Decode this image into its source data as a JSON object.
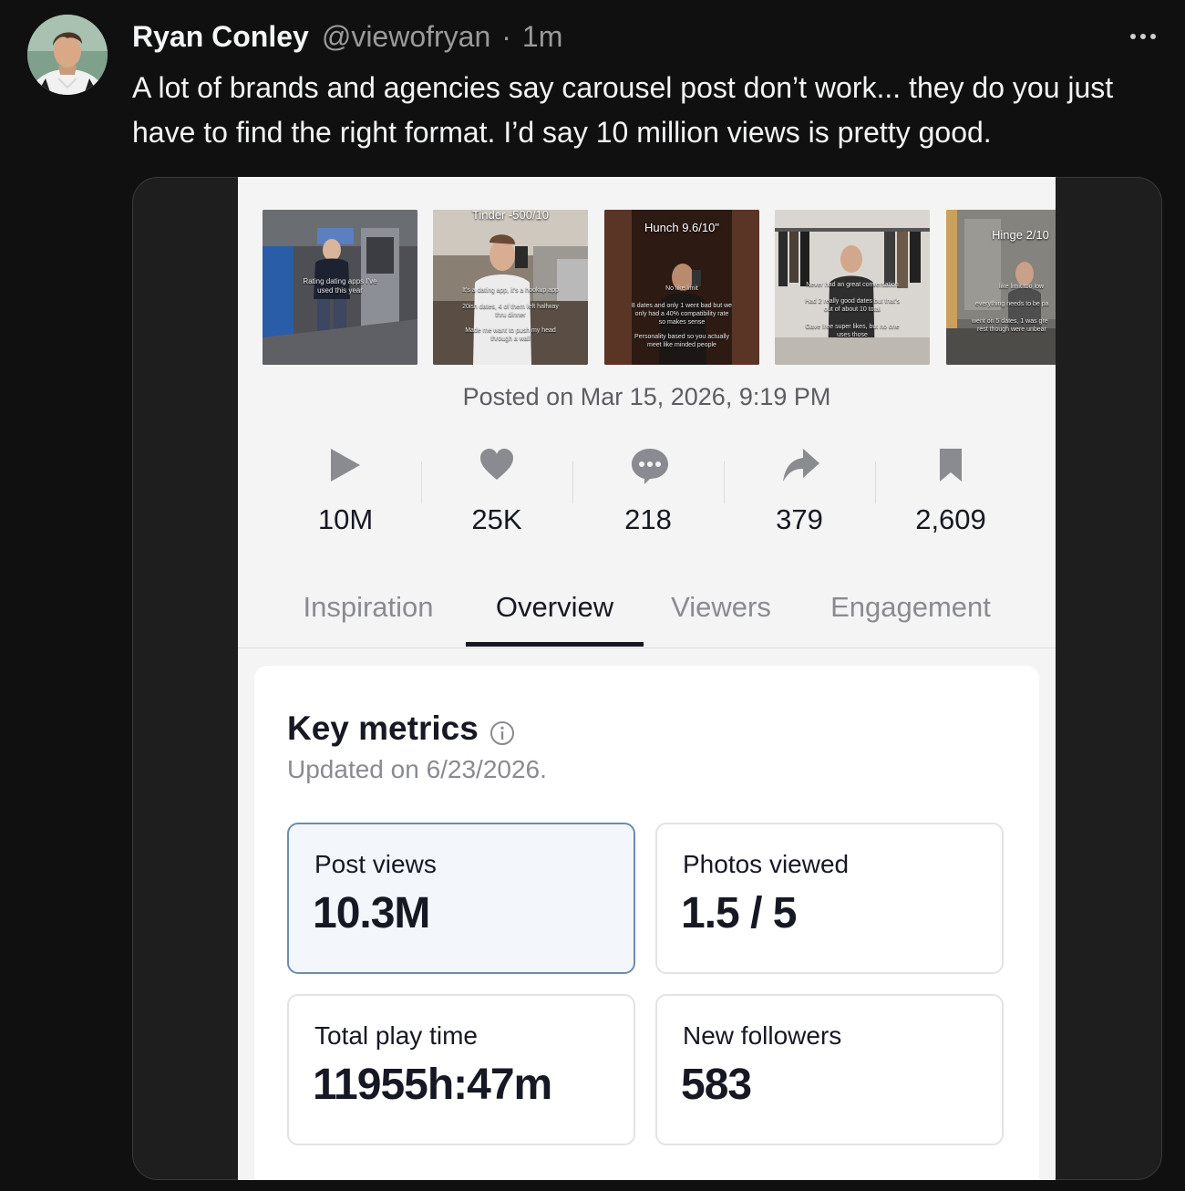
{
  "post": {
    "author": "Ryan Conley",
    "handle": "@viewofryan",
    "separator": "·",
    "time": "1m",
    "text": "A lot of brands and agencies say carousel post don’t work... they do you just have to find the right format. I’d say 10 million views is pretty good."
  },
  "embed": {
    "thumbnails": [
      {
        "caption": "",
        "lines": [
          "Rating dating apps I've",
          "used this year"
        ]
      },
      {
        "caption": "Tinder -500/10",
        "lines": [
          "It's a dating app, it's a hookup app",
          "20ish dates, 4 of them left halfway",
          "thru dinner",
          "Made me want to push my head",
          "through a wall"
        ]
      },
      {
        "caption": "Hunch 9.6/10\"",
        "lines": [
          "No like limit",
          "8 dates and only 1 went bad but we",
          "only had a 40% compatibility rate",
          "so makes sense",
          "Personality based so you actually",
          "meet like minded people"
        ]
      },
      {
        "caption": "",
        "lines": [
          "Never had an great conversation",
          "Had 2 really good dates but that's",
          "out of about 10 total",
          "Gave free super likes, but no one",
          "uses those"
        ]
      },
      {
        "caption": "Hinge 2/10",
        "lines": [
          "like limit too low",
          "everything needs to be pa",
          "went on 5 dates, 1 was gre",
          "rest though were unbear"
        ]
      }
    ],
    "posted_on": "Posted on Mar 15, 2026, 9:19 PM",
    "stats": [
      {
        "icon": "play-icon",
        "value": "10M"
      },
      {
        "icon": "heart-icon",
        "value": "25K"
      },
      {
        "icon": "comment-icon",
        "value": "218"
      },
      {
        "icon": "share-icon",
        "value": "379"
      },
      {
        "icon": "bookmark-icon",
        "value": "2,609"
      }
    ],
    "tabs": [
      "Inspiration",
      "Overview",
      "Viewers",
      "Engagement"
    ],
    "active_tab": "Overview",
    "key_metrics": {
      "title": "Key metrics",
      "updated": "Updated on 6/23/2026.",
      "metrics": [
        {
          "label": "Post views",
          "value": "10.3M",
          "selected": true
        },
        {
          "label": "Photos viewed",
          "value": "1.5 / 5",
          "selected": false
        },
        {
          "label": "Total play time",
          "value": "11955h:47m",
          "selected": false
        },
        {
          "label": "New followers",
          "value": "583",
          "selected": false
        }
      ]
    }
  },
  "colors": {
    "page_bg": "#101010",
    "text_primary": "#f3f5f7",
    "text_secondary": "#9a9a9a",
    "selected_metric_border": "#6f8cab"
  }
}
